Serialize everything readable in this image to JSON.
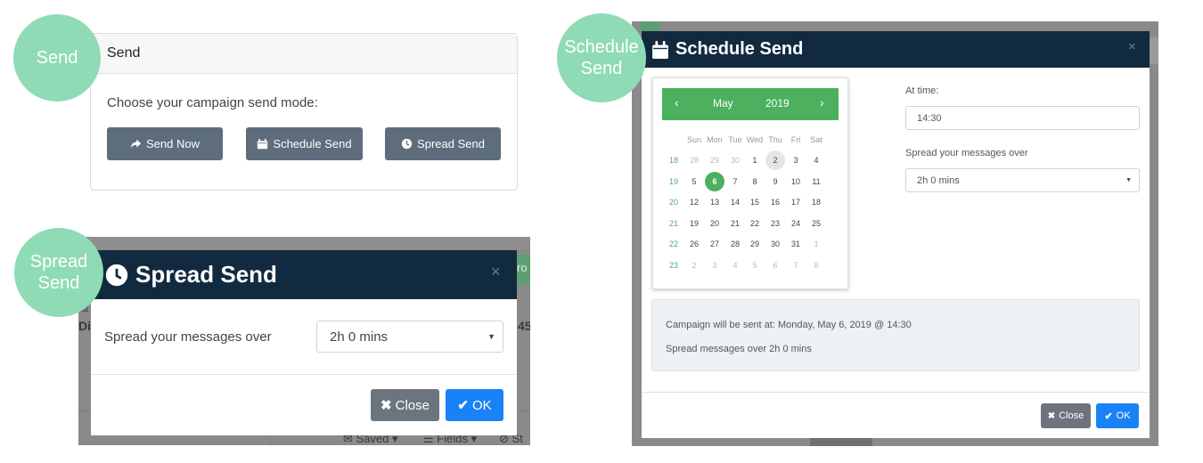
{
  "labels": {
    "send": "Send",
    "schedule": [
      "Schedule",
      "Send"
    ],
    "spread": [
      "Spread",
      "Send"
    ]
  },
  "send_panel": {
    "title": "Send",
    "prompt": "Choose your campaign send mode:",
    "buttons": {
      "send_now": "Send Now",
      "schedule_send": "Schedule Send",
      "spread_send": "Spread Send"
    }
  },
  "spread_modal": {
    "title": "Spread Send",
    "close_x": "×",
    "field_label": "Spread your messages over",
    "duration_value": "2h 0 mins",
    "close_label": "Close",
    "ok_label": "OK",
    "background_fragments": {
      "left_small": "at",
      "left_bold": "Di",
      "right_bold": "45",
      "top_right": "ro",
      "bottom_saved": "Saved",
      "bottom_fields": "Fields",
      "bottom_st": "St"
    }
  },
  "schedule_modal": {
    "title": "Schedule Send",
    "close_x": "×",
    "calendar": {
      "month": "May",
      "year": "2019",
      "prev": "‹",
      "next": "›",
      "days_of_week": [
        "Sun",
        "Mon",
        "Tue",
        "Wed",
        "Thu",
        "Fri",
        "Sat"
      ],
      "weeks": [
        {
          "num": "18",
          "days": [
            {
              "d": "28",
              "o": true
            },
            {
              "d": "29",
              "o": true
            },
            {
              "d": "30",
              "o": true
            },
            {
              "d": "1"
            },
            {
              "d": "2",
              "today": true
            },
            {
              "d": "3"
            },
            {
              "d": "4"
            }
          ]
        },
        {
          "num": "19",
          "days": [
            {
              "d": "5"
            },
            {
              "d": "6",
              "sel": true
            },
            {
              "d": "7"
            },
            {
              "d": "8"
            },
            {
              "d": "9"
            },
            {
              "d": "10"
            },
            {
              "d": "11"
            }
          ]
        },
        {
          "num": "20",
          "days": [
            {
              "d": "12"
            },
            {
              "d": "13"
            },
            {
              "d": "14"
            },
            {
              "d": "15"
            },
            {
              "d": "16"
            },
            {
              "d": "17"
            },
            {
              "d": "18"
            }
          ]
        },
        {
          "num": "21",
          "days": [
            {
              "d": "19"
            },
            {
              "d": "20"
            },
            {
              "d": "21"
            },
            {
              "d": "22"
            },
            {
              "d": "23"
            },
            {
              "d": "24"
            },
            {
              "d": "25"
            }
          ]
        },
        {
          "num": "22",
          "days": [
            {
              "d": "26"
            },
            {
              "d": "27"
            },
            {
              "d": "28"
            },
            {
              "d": "29"
            },
            {
              "d": "30"
            },
            {
              "d": "31"
            },
            {
              "d": "1",
              "o": true
            }
          ]
        },
        {
          "num": "23",
          "days": [
            {
              "d": "2",
              "o": true
            },
            {
              "d": "3",
              "o": true
            },
            {
              "d": "4",
              "o": true
            },
            {
              "d": "5",
              "o": true
            },
            {
              "d": "6",
              "o": true
            },
            {
              "d": "7",
              "o": true
            },
            {
              "d": "8",
              "o": true
            }
          ]
        }
      ]
    },
    "time_label": "At time:",
    "time_value": "14:30",
    "spread_label": "Spread your messages over",
    "spread_value": "2h 0 mins",
    "summary_line1": "Campaign will be sent at: Monday, May 6, 2019 @ 14:30",
    "summary_line2": "Spread messages over 2h 0 mins",
    "close_label": "Close",
    "ok_label": "OK"
  },
  "colors": {
    "label_circle": "#8fdbb5",
    "modal_header": "#122a40",
    "mode_button": "#5d6d7b",
    "calendar_green": "#4cb05e",
    "ok_blue": "#1a82f7",
    "close_gray": "#6c757d"
  }
}
